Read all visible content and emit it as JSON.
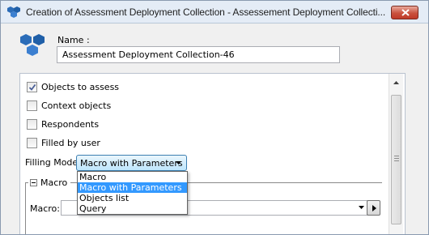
{
  "window": {
    "title": "Creation of Assessment Deployment Collection - Assessement Deployment Collecti...",
    "close_icon": "close-x-icon",
    "app_icon": "blue-cubes-icon"
  },
  "header": {
    "name_label": "Name :",
    "name_value": "Assessment Deployment Collection-46"
  },
  "options": [
    {
      "label": "Objects to assess",
      "checked": true
    },
    {
      "label": "Context objects",
      "checked": false
    },
    {
      "label": "Respondents",
      "checked": false
    },
    {
      "label": "Filled by user",
      "checked": false
    }
  ],
  "filling_mode": {
    "label": "Filling Mode:",
    "selected": "Macro with Parameters",
    "dropdown_options": [
      "Macro",
      "Macro with Parameters",
      "Objects list",
      "Query"
    ],
    "highlighted_index": 1
  },
  "macro_group": {
    "title": "Macro",
    "macro_label": "Macro:",
    "macro_value": ""
  },
  "colors": {
    "selection": "#3399ff",
    "combo_border": "#3c7fb1",
    "icon_blue": "#1f5fa8"
  }
}
